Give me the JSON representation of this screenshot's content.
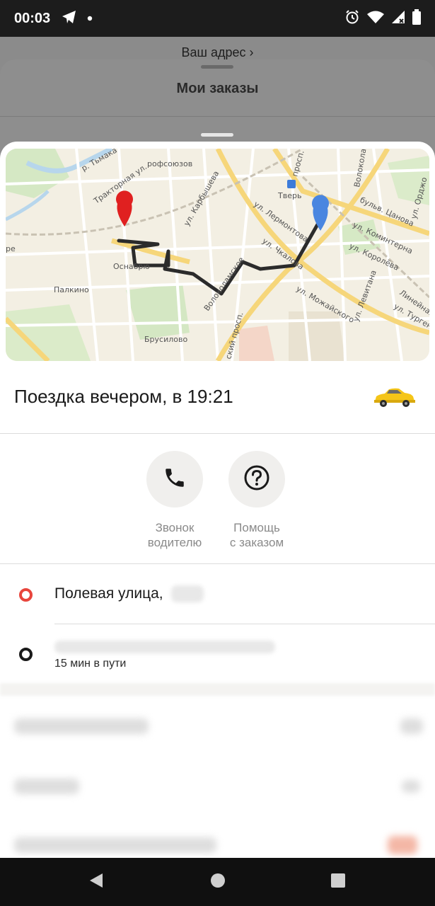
{
  "status_bar": {
    "time": "00:03",
    "left_icons": [
      "telegram-icon",
      "notification-dot-icon"
    ],
    "right_icons": [
      "alarm-icon",
      "wifi-icon",
      "cellular-no-data-icon",
      "battery-icon"
    ]
  },
  "background": {
    "address_link": "Ваш адрес ›",
    "sheet_title": "Мои заказы"
  },
  "map": {
    "labels": {
      "river": "р. Тьмака",
      "traktornaya": "Тракторная ул.",
      "profsoyuzov": "рофсоюзов",
      "karbysheva": "ул. Карбышева",
      "tver": "Тверь",
      "prosp": "просп.",
      "volokol": "Волоколамский",
      "bulvar": "бульв. Цанова",
      "lermontova": "ул. Лермонтова",
      "komintern": "ул. Коминтерна",
      "ordzh": "ул. Орджо",
      "chkalova": "ул. Чкалова",
      "koroleva": "ул. Королёва",
      "osnab": "Оснабрю",
      "palkino": "Палкино",
      "volokolamskoe": "Волоколамское",
      "mozhayskogo": "ул. Можайского",
      "levitana": "ул. Левитана",
      "lineynaya": "Линейная",
      "turgeneva": "ул. Тургенева",
      "brusilovo": "Брусилово",
      "skiy": "ский просп.",
      "re": "ре"
    }
  },
  "trip": {
    "title": "Поездка вечером, в 19:21",
    "vehicle_icon": "taxi-car-icon"
  },
  "actions": [
    {
      "icon": "phone-icon",
      "label_line1": "Звонок",
      "label_line2": "водителю"
    },
    {
      "icon": "help-icon",
      "label_line1": "Помощь",
      "label_line2": "с заказом"
    }
  ],
  "route": {
    "from_address": "Полевая улица,",
    "to_duration": "15 мин в пути"
  },
  "colors": {
    "origin_marker": "#e8453c",
    "destination_marker": "#4a86e0",
    "route_line": "#2b2b2b",
    "taxi_yellow": "#f5c518"
  }
}
